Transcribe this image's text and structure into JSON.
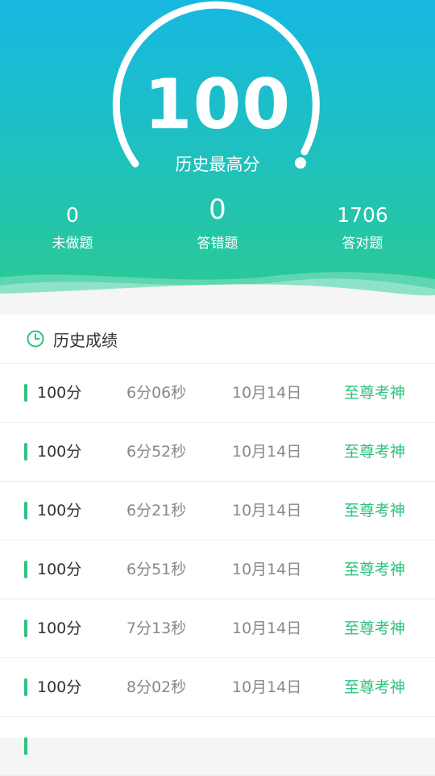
{
  "header": {
    "best_score": "100",
    "best_score_label": "历史最高分",
    "stats": [
      {
        "value": "0",
        "label": "未做题"
      },
      {
        "value": "0",
        "label": "答错题"
      },
      {
        "value": "1706",
        "label": "答对题"
      }
    ]
  },
  "history": {
    "title": "历史成绩",
    "records": [
      {
        "score": "100分",
        "duration": "6分06秒",
        "date": "10月14日",
        "rank": "至尊考神"
      },
      {
        "score": "100分",
        "duration": "6分52秒",
        "date": "10月14日",
        "rank": "至尊考神"
      },
      {
        "score": "100分",
        "duration": "6分21秒",
        "date": "10月14日",
        "rank": "至尊考神"
      },
      {
        "score": "100分",
        "duration": "6分51秒",
        "date": "10月14日",
        "rank": "至尊考神"
      },
      {
        "score": "100分",
        "duration": "7分13秒",
        "date": "10月14日",
        "rank": "至尊考神"
      },
      {
        "score": "100分",
        "duration": "8分02秒",
        "date": "10月14日",
        "rank": "至尊考神"
      }
    ]
  },
  "colors": {
    "accent": "#2ec27e",
    "gradient_top": "#17b8e0",
    "gradient_bottom": "#2bcb8f"
  },
  "icons": {
    "history_icon": "clock-icon"
  }
}
